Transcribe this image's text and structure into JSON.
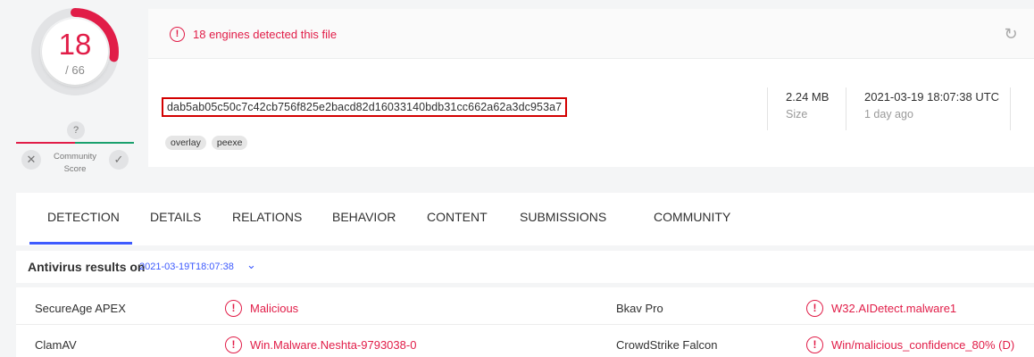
{
  "score": {
    "detections": "18",
    "total": "/ 66",
    "community_question": "?",
    "community_label_1": "Community",
    "community_label_2": "Score",
    "reject_icon": "✕",
    "approve_icon": "✓",
    "detected_fraction": 0.2727
  },
  "colors": {
    "malicious": "#e11d48",
    "accent": "#3d5afe",
    "benign": "#1aa06d"
  },
  "header": {
    "detect_text": "18 engines detected this file",
    "alert_icon": "!",
    "reload_icon": "↻",
    "hash": "dab5ab05c50c7c42cb756f825e2bacd82d16033140bdb31cc662a62a3dc953a7",
    "tags": [
      "overlay",
      "peexe"
    ],
    "size_value": "2.24 MB",
    "size_label": "Size",
    "date_value": "2021-03-19 18:07:38 UTC",
    "date_label": "1 day ago"
  },
  "tabs": [
    "DETECTION",
    "DETAILS",
    "RELATIONS",
    "BEHAVIOR",
    "CONTENT",
    "SUBMISSIONS",
    "COMMUNITY"
  ],
  "results": {
    "title": "Antivirus results on",
    "date": "2021-03-19T18:07:38",
    "chevron": "⌄",
    "rows": [
      {
        "left_engine": "SecureAge APEX",
        "left_result": "Malicious",
        "right_engine": "Bkav Pro",
        "right_result": "W32.AIDetect.malware1"
      },
      {
        "left_engine": "ClamAV",
        "left_result": "Win.Malware.Neshta-9793038-0",
        "right_engine": "CrowdStrike Falcon",
        "right_result": "Win/malicious_confidence_80% (D)"
      }
    ]
  }
}
